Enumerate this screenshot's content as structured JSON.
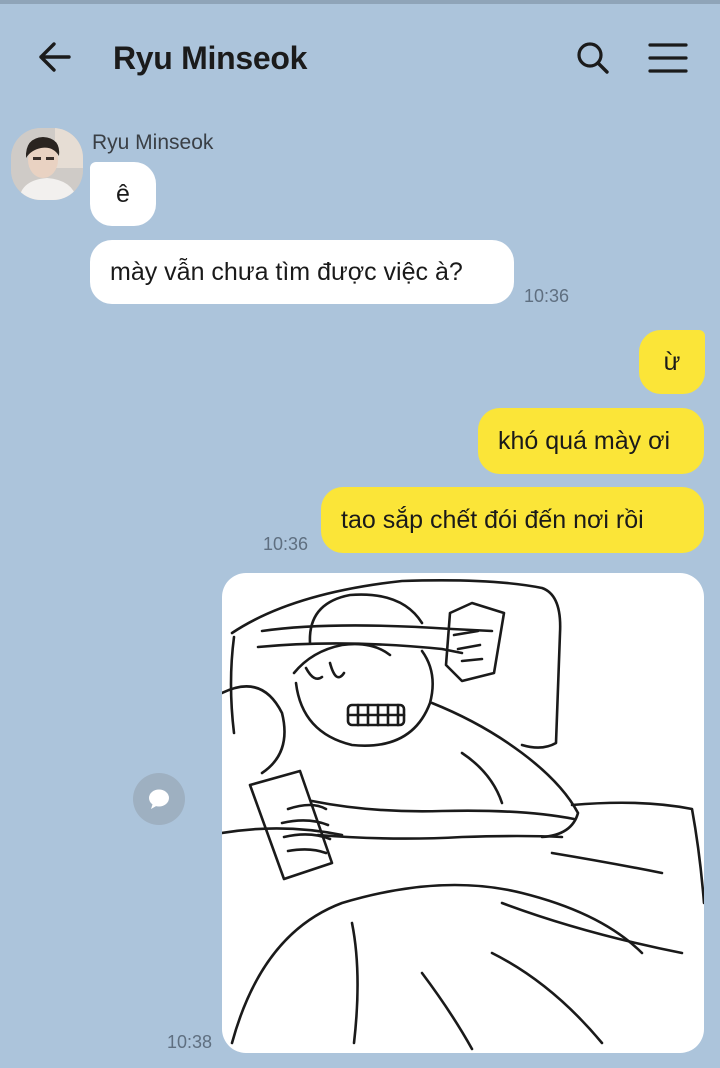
{
  "header": {
    "title": "Ryu Minseok"
  },
  "messages": [
    {
      "side": "incoming",
      "sender": "Ryu Minseok",
      "text": "ê"
    },
    {
      "side": "incoming",
      "text": "mày vẫn chưa tìm được việc à?",
      "time": "10:36"
    },
    {
      "side": "outgoing",
      "text": "ừ"
    },
    {
      "side": "outgoing",
      "text": "khó quá mày ơi"
    },
    {
      "side": "outgoing",
      "text": "tao sắp chết đói đến nơi rồi",
      "time": "10:36"
    },
    {
      "side": "outgoing",
      "type": "image",
      "time": "10:38"
    }
  ],
  "icons": {
    "back": "arrow-left-icon",
    "search": "search-icon",
    "menu": "hamburger-menu-icon",
    "reply": "chat-bubble-icon"
  },
  "colors": {
    "background": "#acc4db",
    "incoming_bubble": "#ffffff",
    "outgoing_bubble": "#fbe538"
  }
}
